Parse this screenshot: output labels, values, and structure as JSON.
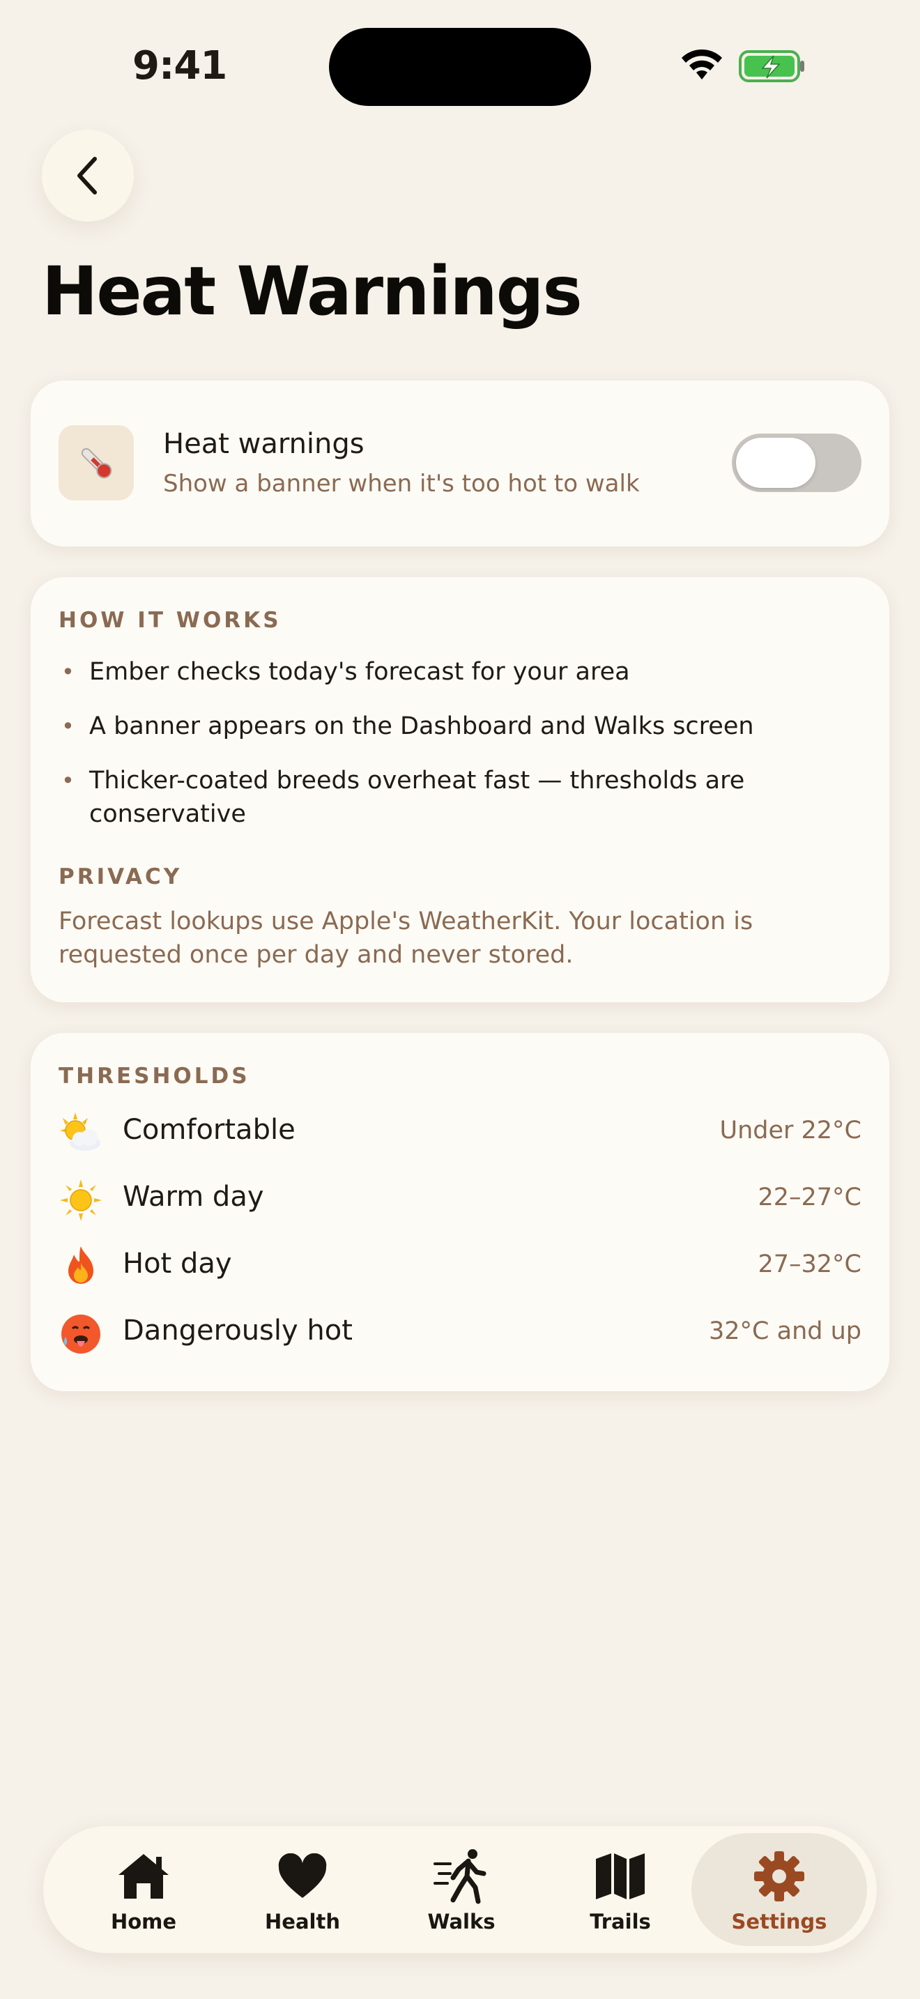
{
  "status_bar": {
    "time": "9:41"
  },
  "page": {
    "title": "Heat Warnings"
  },
  "toggle_card": {
    "title": "Heat warnings",
    "subtitle": "Show a banner when it's too hot to walk",
    "icon": "thermometer-icon",
    "enabled": false
  },
  "how_it_works": {
    "heading": "HOW IT WORKS",
    "bullets": [
      "Ember checks today's forecast for your area",
      "A banner appears on the Dashboard and Walks screen",
      "Thicker-coated breeds overheat fast — thresholds are conservative"
    ],
    "privacy_heading": "PRIVACY",
    "privacy_text": "Forecast lookups use Apple's WeatherKit. Your location is requested once per day and never stored."
  },
  "thresholds": {
    "heading": "THRESHOLDS",
    "rows": [
      {
        "icon": "sun-behind-cloud-icon",
        "label": "Comfortable",
        "value": "Under 22°C"
      },
      {
        "icon": "sun-icon",
        "label": "Warm day",
        "value": "22–27°C"
      },
      {
        "icon": "fire-icon",
        "label": "Hot day",
        "value": "27–32°C"
      },
      {
        "icon": "hot-face-icon",
        "label": "Dangerously hot",
        "value": "32°C and up"
      }
    ]
  },
  "tabbar": {
    "tabs": [
      {
        "label": "Home",
        "icon": "house-icon"
      },
      {
        "label": "Health",
        "icon": "heart-icon"
      },
      {
        "label": "Walks",
        "icon": "walking-icon"
      },
      {
        "label": "Trails",
        "icon": "map-icon"
      },
      {
        "label": "Settings",
        "icon": "gear-icon"
      }
    ],
    "active": "Settings",
    "active_color": "#9a4a22"
  }
}
